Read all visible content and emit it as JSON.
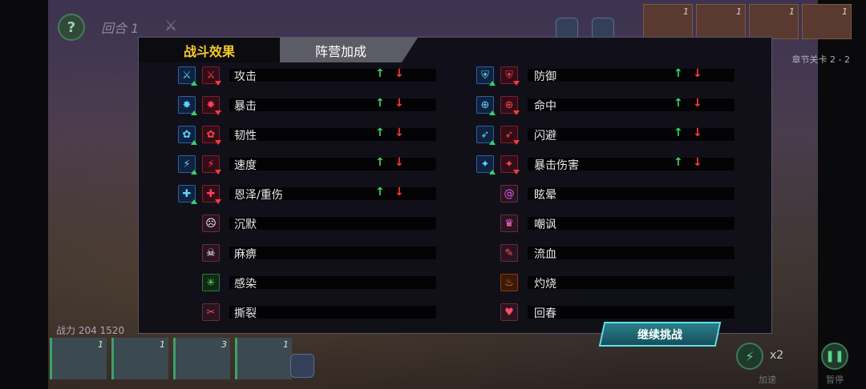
{
  "hud": {
    "help_label": "?",
    "round_label": "回合 1",
    "stage_label": "章节关卡 2 - 2",
    "power_label": "战力 204 1520",
    "enemy_counts": [
      "1",
      "1",
      "1",
      "1"
    ],
    "hero_counts": [
      "1",
      "1",
      "3",
      "1"
    ],
    "speed_label": "x2",
    "speed_caption": "加速",
    "pause_caption": "暂停"
  },
  "modal": {
    "tabs": [
      {
        "label": "战斗效果",
        "active": true
      },
      {
        "label": "阵营加成",
        "active": false
      }
    ],
    "stat_rows_left": [
      {
        "label": "攻击",
        "buff_icon": "attack-up-icon",
        "debuff_icon": "attack-down-icon",
        "up": "↑",
        "down": "↓"
      },
      {
        "label": "暴击",
        "buff_icon": "crit-up-icon",
        "debuff_icon": "crit-down-icon",
        "up": "↑",
        "down": "↓"
      },
      {
        "label": "韧性",
        "buff_icon": "toughness-up-icon",
        "debuff_icon": "toughness-down-icon",
        "up": "↑",
        "down": "↓"
      },
      {
        "label": "速度",
        "buff_icon": "speed-up-icon",
        "debuff_icon": "speed-down-icon",
        "up": "↑",
        "down": "↓"
      },
      {
        "label": "恩泽/重伤",
        "buff_icon": "grace-up-icon",
        "debuff_icon": "wound-down-icon",
        "up": "↑",
        "down": "↓"
      }
    ],
    "stat_rows_right": [
      {
        "label": "防御",
        "buff_icon": "defense-up-icon",
        "debuff_icon": "defense-down-icon",
        "up": "↑",
        "down": "↓"
      },
      {
        "label": "命中",
        "buff_icon": "accuracy-up-icon",
        "debuff_icon": "accuracy-down-icon",
        "up": "↑",
        "down": "↓"
      },
      {
        "label": "闪避",
        "buff_icon": "dodge-up-icon",
        "debuff_icon": "dodge-down-icon",
        "up": "↑",
        "down": "↓"
      },
      {
        "label": "暴击伤害",
        "buff_icon": "crit-damage-up-icon",
        "debuff_icon": "crit-damage-down-icon",
        "up": "↑",
        "down": "↓"
      }
    ],
    "status_rows_left": [
      {
        "label": "沉默",
        "icon": "silence-icon"
      },
      {
        "label": "麻痹",
        "icon": "paralysis-icon"
      },
      {
        "label": "感染",
        "icon": "infection-icon"
      },
      {
        "label": "撕裂",
        "icon": "tear-icon"
      }
    ],
    "status_rows_right": [
      {
        "label": "眩晕",
        "icon": "stun-icon"
      },
      {
        "label": "嘲讽",
        "icon": "taunt-icon"
      },
      {
        "label": "流血",
        "icon": "bleed-icon"
      },
      {
        "label": "灼烧",
        "icon": "burn-icon"
      },
      {
        "label": "回春",
        "icon": "regen-icon"
      }
    ],
    "continue_label": "继续挑战"
  },
  "colors": {
    "tab_active_text": "#f5c92a",
    "arrow_up": "#3ad85c",
    "arrow_down": "#ff3b30",
    "continue_button": "#2a7f8a"
  }
}
